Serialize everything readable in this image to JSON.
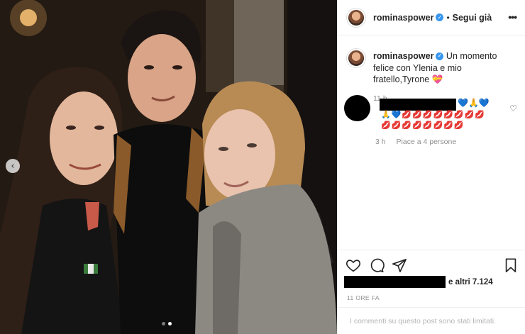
{
  "post": {
    "username": "rominaspower",
    "verified_glyph": "✓",
    "separator": "•",
    "follow_label": "Segui già",
    "more_glyph": "•••"
  },
  "caption": {
    "username": "rominaspower",
    "text": "Un momento felice con Ylenia e mio fratello,Tyrone 💝",
    "time": "11 h"
  },
  "comment": {
    "emoji_line1": "💙🙏💙",
    "emoji_line2": "🙏💙💋💋💋💋💋💋💋💋",
    "emoji_line3": "💋💋💋💋💋💋💋💋",
    "time": "3 h",
    "likes": "Piace a 4 persone",
    "heart_glyph": "♡"
  },
  "actions": {
    "likes_suffix": "e altri 7.124",
    "post_time": "11 ORE FA",
    "comments_limited": "I commenti su questo post sono stati limitati."
  },
  "carousel": {
    "prev_glyph": "‹",
    "slides": 2,
    "active_slide": 2
  },
  "icons": [
    "heart-icon",
    "comment-icon",
    "share-icon",
    "bookmark-icon",
    "chevron-left-icon",
    "more-icon",
    "verified-icon"
  ],
  "colors": {
    "verified": "#3897f0",
    "muted": "#8e8e8e",
    "border": "#efefef"
  }
}
